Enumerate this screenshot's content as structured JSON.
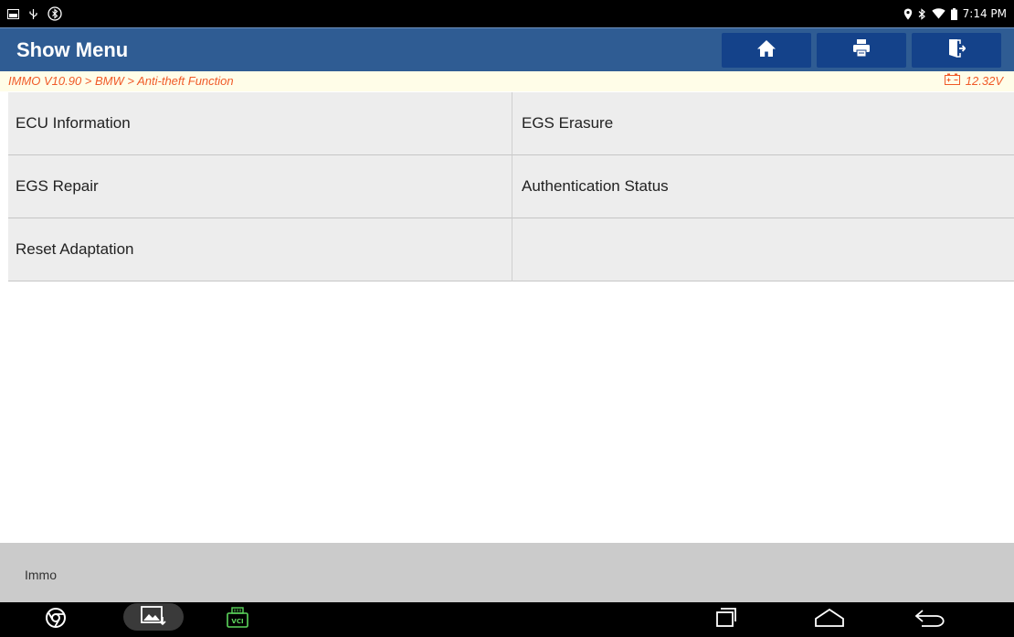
{
  "statusbar": {
    "time": "7:14 PM",
    "left_icons": [
      "screenshot-icon",
      "usb-icon",
      "bluetooth-connected-icon"
    ],
    "right_icons": [
      "location-icon",
      "bluetooth-icon",
      "wifi-icon",
      "battery-icon"
    ]
  },
  "header": {
    "title": "Show Menu",
    "buttons": [
      "home-icon",
      "print-icon",
      "exit-icon"
    ],
    "bg_color": "#2f5c93",
    "button_color": "#14428a"
  },
  "breadcrumb": {
    "path": "IMMO V10.90 > BMW > Anti-theft Function",
    "voltage": "12.32V",
    "text_color": "#f05a28"
  },
  "menu": {
    "items": [
      {
        "label": "ECU Information"
      },
      {
        "label": "EGS Erasure"
      },
      {
        "label": "EGS Repair"
      },
      {
        "label": "Authentication Status"
      },
      {
        "label": "Reset Adaptation"
      },
      {
        "label": ""
      }
    ]
  },
  "footer": {
    "text": "Immo"
  },
  "navbar": {
    "left_icons": [
      "chrome-icon",
      "gallery-icon",
      "vci-icon"
    ],
    "vci_label": "VCI",
    "right_icons": [
      "recent-apps-icon",
      "home-nav-icon",
      "back-icon"
    ]
  }
}
